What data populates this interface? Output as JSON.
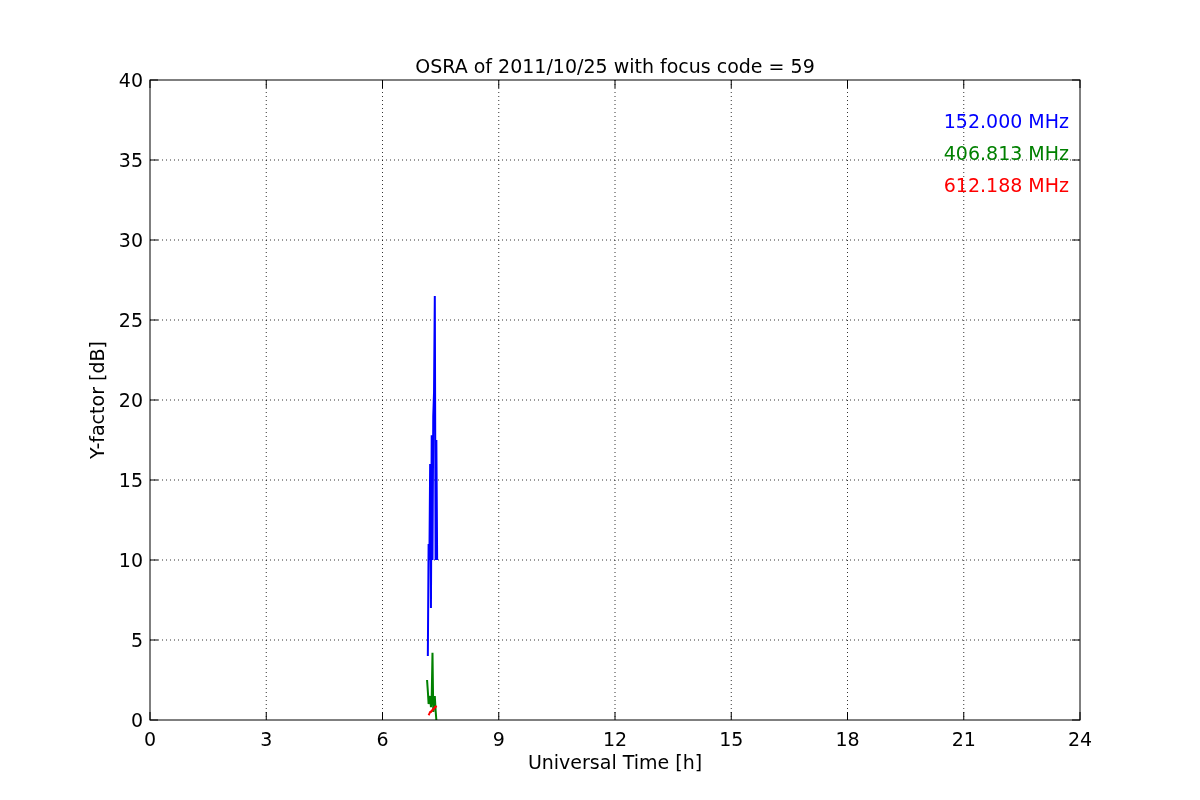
{
  "figure": {
    "chart_data": {
      "type": "line",
      "title": "OSRA of 2011/10/25 with focus code = 59",
      "xlabel": "Universal Time [h]",
      "ylabel": "Y-factor [dB]",
      "x": [
        7.15,
        7.17,
        7.19,
        7.21,
        7.23,
        7.25,
        7.27,
        7.29,
        7.31,
        7.33,
        7.35,
        7.37,
        7.39,
        7.41
      ],
      "series": [
        {
          "name": "152.000 MHz",
          "color": "#0000ff",
          "values": [
            null,
            4,
            11,
            10,
            16,
            7,
            17.8,
            10,
            19,
            20.5,
            26.5,
            10,
            17.5,
            10
          ]
        },
        {
          "name": "406.813 MHz",
          "color": "#008000",
          "values": [
            2.5,
            1.8,
            1,
            1.2,
            1.5,
            0.8,
            1.4,
            4.2,
            0.5,
            1.2,
            1.5,
            0.6,
            0,
            null
          ]
        },
        {
          "name": "612.188 MHz",
          "color": "#ff0000",
          "values": [
            null,
            null,
            0.3,
            0.4,
            0.5,
            0.5,
            0.6,
            0.6,
            0.7,
            0.7,
            0.8,
            0.8,
            0.9,
            null
          ]
        }
      ],
      "grid": true,
      "xlim": [
        0,
        24
      ],
      "ylim": [
        0,
        40
      ],
      "xticks": [
        0,
        3,
        6,
        9,
        12,
        15,
        18,
        21,
        24
      ],
      "yticks": [
        0,
        5,
        10,
        15,
        20,
        25,
        30,
        35,
        40
      ]
    }
  }
}
